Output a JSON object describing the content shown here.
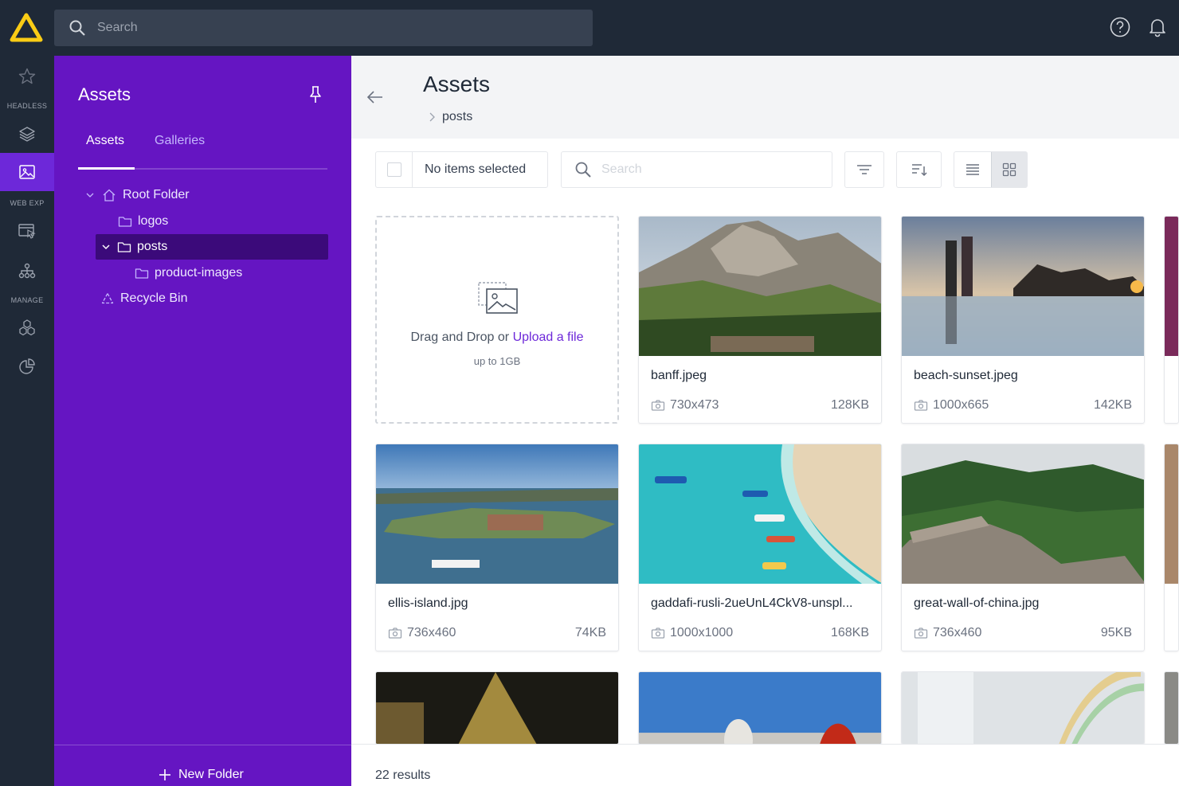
{
  "topbar": {
    "search_placeholder": "Search",
    "icons": [
      "logo-icon",
      "search-icon",
      "help-icon",
      "bell-icon"
    ]
  },
  "rail": {
    "sections": [
      "HEADLESS",
      "WEB EXP",
      "MANAGE"
    ],
    "icons": [
      "star-icon",
      "layers-icon",
      "image-icon",
      "web-page-icon",
      "sitemap-icon",
      "cubes-icon",
      "pie-chart-icon"
    ]
  },
  "tree": {
    "title": "Assets",
    "tabs": [
      "Assets",
      "Galleries"
    ],
    "nodes": [
      {
        "label": "Root Folder",
        "icon": "home-icon"
      },
      {
        "label": "logos",
        "icon": "folder-icon"
      },
      {
        "label": "posts",
        "icon": "folder-icon",
        "selected": true
      },
      {
        "label": "product-images",
        "icon": "folder-icon"
      },
      {
        "label": "Recycle Bin",
        "icon": "recycle-icon"
      }
    ],
    "new_folder": "New Folder"
  },
  "main": {
    "title": "Assets",
    "breadcrumb": "posts",
    "selection_text": "No items selected",
    "search_placeholder": "Search",
    "upload": {
      "text": "Drag and Drop or",
      "link": "Upload a file",
      "limit": "up to 1GB"
    },
    "assets": [
      {
        "name": "banff.jpeg",
        "dims": "730x473",
        "size": "128KB"
      },
      {
        "name": "beach-sunset.jpeg",
        "dims": "1000x665",
        "size": "142KB"
      },
      {
        "name": "ellis-island.jpg",
        "dims": "736x460",
        "size": "74KB"
      },
      {
        "name": "gaddafi-rusli-2ueUnL4CkV8-unspl...",
        "dims": "1000x1000",
        "size": "168KB"
      },
      {
        "name": "great-wall-of-china.jpg",
        "dims": "736x460",
        "size": "95KB"
      }
    ],
    "results": "22 results"
  },
  "colors": {
    "topbar": "#1f2937",
    "tree_bg": "#6515c2",
    "accent": "#6d28d9",
    "logo": "#facc15"
  }
}
